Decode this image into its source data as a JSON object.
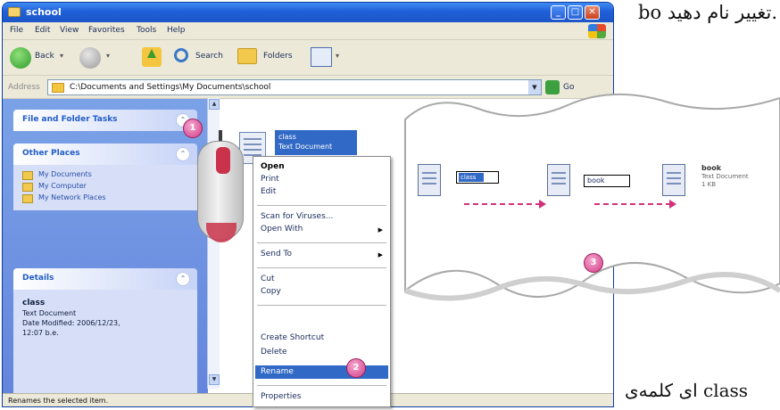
{
  "window": {
    "title": "school",
    "menu": [
      "File",
      "Edit",
      "View",
      "Favorites",
      "Tools",
      "Help"
    ],
    "toolbar": {
      "back_label": "Back",
      "search_label": "Search",
      "folders_label": "Folders"
    },
    "address": {
      "label": "Address",
      "path": "C:\\Documents and Settings\\My Documents\\school",
      "go_label": "Go"
    },
    "left_pane": {
      "file_tasks_title": "File and Folder Tasks",
      "other_places_title": "Other Places",
      "other_places": [
        "My Documents",
        "My Computer",
        "My Network Places"
      ],
      "details_title": "Details",
      "details": {
        "name": "class",
        "type": "Text Document",
        "modified": "Date Modified: 2006/12/23,",
        "time": "12:07 b.e."
      }
    },
    "file": {
      "name": "class",
      "type": "Text Document"
    },
    "status": "Renames the selected item."
  },
  "context_menu": {
    "group1": [
      "Open",
      "Print",
      "Edit"
    ],
    "group2": [
      "Scan for Viruses...",
      "Open With"
    ],
    "group3": [
      "Send To"
    ],
    "group4": [
      "Cut",
      "Copy"
    ],
    "group5": [
      "Create Shortcut",
      "Delete",
      "Rename"
    ],
    "group6": [
      "Properties"
    ],
    "selected": "Rename"
  },
  "steps": [
    "1",
    "2",
    "3"
  ],
  "rename_demo": {
    "editing_text": "class",
    "typed_text": "book",
    "result_name": "book",
    "result_type": "Text Document",
    "result_size": "1 KB"
  },
  "caption": {
    "top_text": "bo تغییر نام دهید.",
    "bottom_text": "ای کلمه‌ی class"
  },
  "colors": {
    "title_blue": "#1f5fd8",
    "selection_blue": "#3169c6",
    "step_pink": "#d23d8a",
    "taskpane_blue": "#6e90e0"
  }
}
